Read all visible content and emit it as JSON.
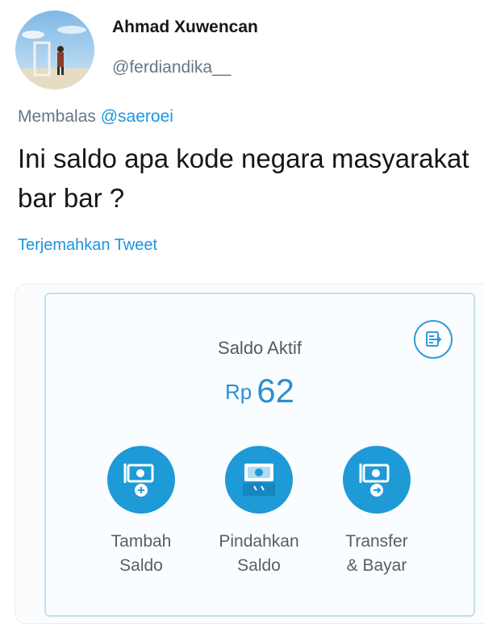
{
  "tweet": {
    "display_name": "Ahmad Xuwencan",
    "handle": "@ferdiandika__",
    "reply_prefix": "Membalas",
    "reply_to": "@saeroei",
    "text": "Ini saldo apa kode negara masyarakat bar bar ?",
    "translate_link": "Terjemahkan Tweet"
  },
  "wallet_card": {
    "balance_label": "Saldo Aktif",
    "currency": "Rp",
    "balance_amount": "62",
    "accent_color": "#1e9ad6",
    "actions": [
      {
        "icon": "money-plus-icon",
        "label_line1": "Tambah",
        "label_line2": "Saldo"
      },
      {
        "icon": "money-transfer-icon",
        "label_line1": "Pindahkan",
        "label_line2": "Saldo"
      },
      {
        "icon": "money-arrow-icon",
        "label_line1": "Transfer",
        "label_line2": "& Bayar"
      }
    ],
    "history_icon": "history-icon"
  }
}
